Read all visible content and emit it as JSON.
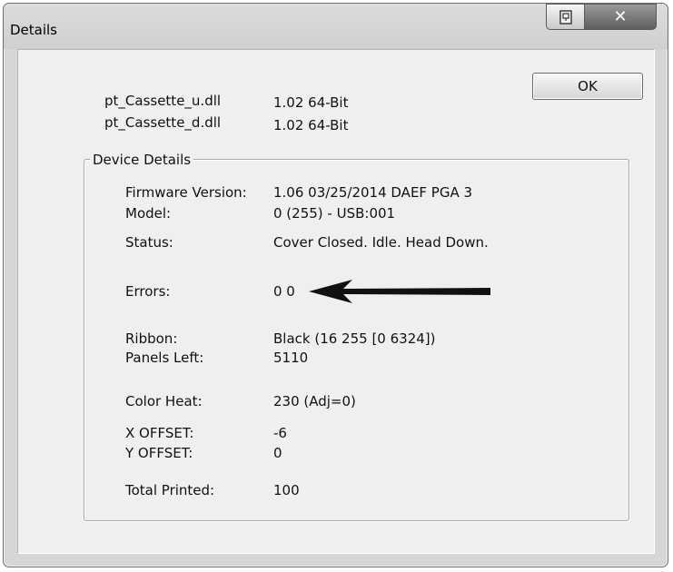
{
  "window": {
    "title": "Details",
    "ok_label": "OK"
  },
  "dlls": [
    {
      "name": "pt_Cassette_u.dll",
      "version": "1.02  64-Bit"
    },
    {
      "name": "pt_Cassette_d.dll",
      "version": "1.02  64-Bit"
    }
  ],
  "device_details": {
    "legend": "Device Details",
    "rows": [
      {
        "label": "Firmware Version:",
        "value": "1.06 03/25/2014  DAEF  PGA 3"
      },
      {
        "label": "Model:",
        "value": "0 (255) - USB:001"
      },
      {
        "label": "Status:",
        "value": "Cover Closed. Idle. Head Down."
      },
      {
        "label": "Errors:",
        "value": "0 0"
      },
      {
        "label": "Ribbon:",
        "value": "Black (16 255 [0 6324])"
      },
      {
        "label": "Panels Left:",
        "value": "5110"
      },
      {
        "label": "Color Heat:",
        "value": "230  (Adj=0)"
      },
      {
        "label": "X OFFSET:",
        "value": "-6"
      },
      {
        "label": "Y OFFSET:",
        "value": "0"
      },
      {
        "label": "Total Printed:",
        "value": "100"
      }
    ]
  },
  "colors": {
    "arrow": "#111111",
    "close_button": "#6a6a6a"
  },
  "icons": {
    "help_button": "context-help-icon",
    "close_button": "close-icon",
    "annotation": "left-arrow-icon"
  }
}
